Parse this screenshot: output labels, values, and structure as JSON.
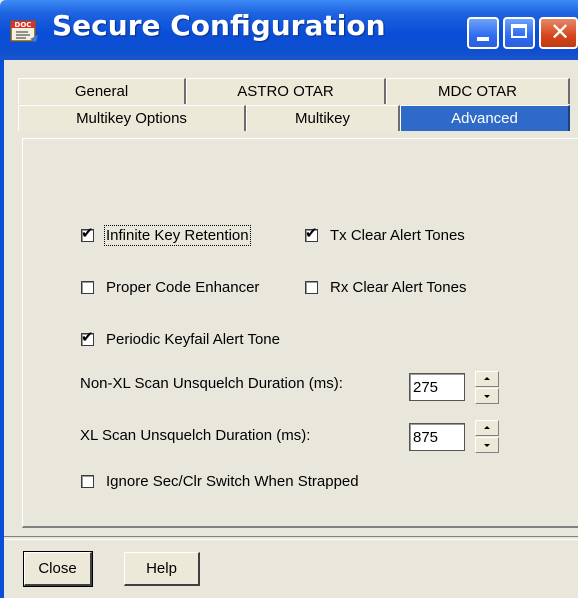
{
  "window": {
    "title": "Secure Configuration",
    "icon": "doc-app-icon",
    "icon_text": "DOC"
  },
  "title_buttons": {
    "minimize": "minimize-icon",
    "maximize": "maximize-icon",
    "close": "close-icon",
    "close_glyph": "✕"
  },
  "tabs": {
    "back_row": [
      "General",
      "ASTRO OTAR",
      "MDC OTAR"
    ],
    "front_row": [
      "Multikey Options",
      "Multikey",
      "Advanced"
    ],
    "selected": "Advanced"
  },
  "options": {
    "infinite_key_retention": {
      "label": "Infinite Key Retention",
      "checked": true
    },
    "tx_clear_alert_tones": {
      "label": "Tx Clear Alert Tones",
      "checked": true
    },
    "proper_code_enhancer": {
      "label": "Proper Code Enhancer",
      "checked": false
    },
    "rx_clear_alert_tones": {
      "label": "Rx Clear Alert Tones",
      "checked": false
    },
    "periodic_keyfail_alert_tone": {
      "label": "Periodic Keyfail Alert Tone",
      "checked": true
    },
    "ignore_sec_clr_switch": {
      "label": "Ignore Sec/Clr Switch When Strapped",
      "checked": false
    }
  },
  "fields": {
    "non_xl_scan": {
      "label": "Non-XL Scan Unsquelch Duration (ms):",
      "value": "275"
    },
    "xl_scan": {
      "label": "XL Scan Unsquelch Duration (ms):",
      "value": "875"
    }
  },
  "check_glyph": "✔",
  "buttons": {
    "close": "Close",
    "help": "Help"
  },
  "colors": {
    "title_bar": "#0a4ed8",
    "selected_tab": "#2f6ac8",
    "dialog_bg": "#e9e7dc",
    "close_button": "#d6461c"
  }
}
